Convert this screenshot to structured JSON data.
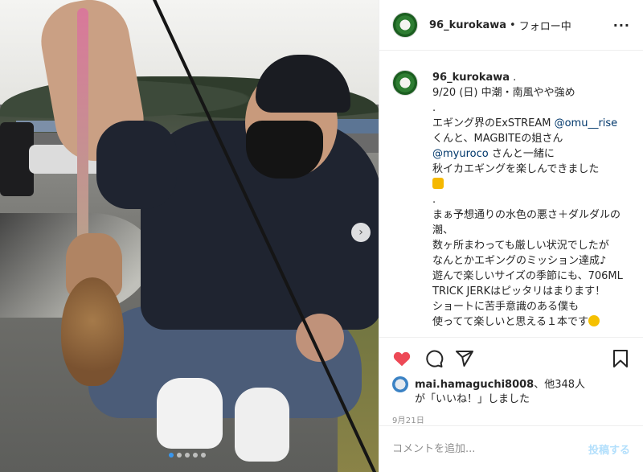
{
  "post": {
    "username": "96_kurokawa",
    "separator": "•",
    "follow_status": "フォロー中",
    "more_icon": "more-dots-icon"
  },
  "caption": {
    "username": "96_kurokawa",
    "lines": [
      "9/20 (日) 中潮・南風やや強め",
      ".",
      "エギング界のExSTREAM ",
      "くんと、MAGBITEの姐さん",
      " さんと一緒に",
      "秋イカエギングを楽しんできました",
      ".",
      "まぁ予想通りの水色の悪さ＋ダルダルの潮、",
      "数ヶ所まわっても厳しい状況でしたが",
      "なんとかエギングのミッション達成♪",
      "遊んで楽しいサイズの季節にも、706ML TRICK JERKはピッタリはまります！",
      "ショートに苦手意識のある僕も",
      "使ってて楽しいと思える１本です"
    ],
    "mention1": "@omu__rise",
    "mention2": "@myuroco"
  },
  "actions": {
    "heart_icon": "heart-filled-icon",
    "comment_icon": "comment-icon",
    "share_icon": "share-icon",
    "save_icon": "bookmark-icon",
    "heart_color": "#ed4956"
  },
  "likes": {
    "user": "mai.hamaguchi8008",
    "others": "、他348人",
    "suffix": "が「いいね！」しました"
  },
  "date": "9月21日",
  "comment": {
    "placeholder": "コメントを追加...",
    "post_label": "投稿する"
  },
  "carousel": {
    "dot_count": 5,
    "active_index": 0
  }
}
